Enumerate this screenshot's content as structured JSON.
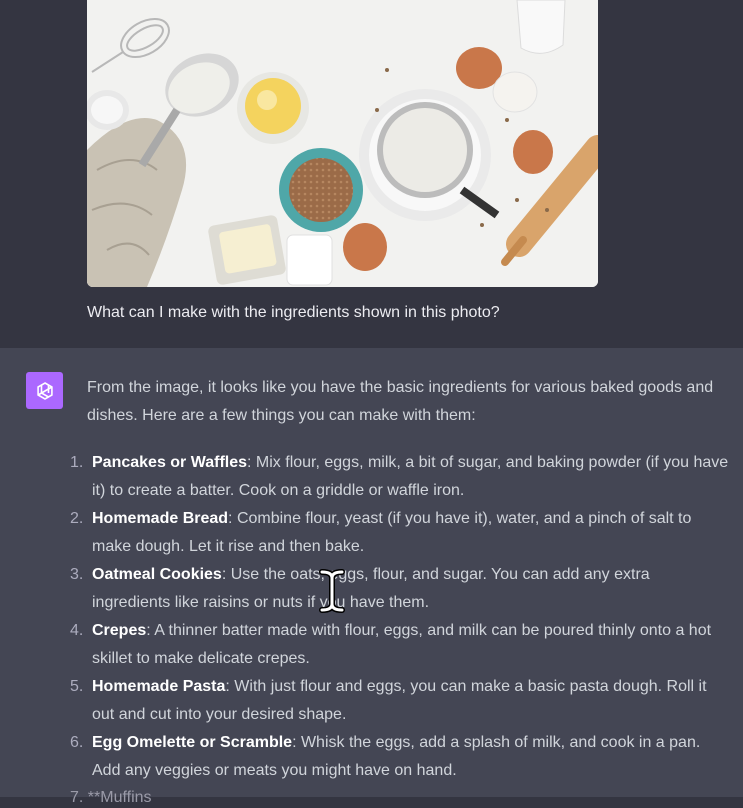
{
  "user_message": {
    "image": {
      "subject": "baking ingredients flat lay",
      "colors": {
        "background": "#f2f2f0",
        "egg": "#c9774a",
        "flour": "#efefea",
        "oats_bowl": "#4fa7a8",
        "wood": "#d9a46b"
      }
    },
    "text": "What can I make with the ingredients shown in this photo?"
  },
  "assistant_message": {
    "avatar_icon": "openai-logo-icon",
    "avatar_color": "#ab68ff",
    "intro": "From the image, it looks like you have the basic ingredients for various baked goods and dishes. Here are a few things you can make with them:",
    "items": [
      {
        "number": "1.",
        "title": "Pancakes or Waffles",
        "text": ": Mix flour, eggs, milk, a bit of sugar, and baking powder (if you have it) to create a batter. Cook on a griddle or waffle iron."
      },
      {
        "number": "2.",
        "title": "Homemade Bread",
        "text": ": Combine flour, yeast (if you have it), water, and a pinch of salt to make dough. Let it rise and then bake."
      },
      {
        "number": "3.",
        "title": "Oatmeal Cookies",
        "text": ": Use the oats, eggs, flour, and sugar. You can add any extra ingredients like raisins or nuts if you have them."
      },
      {
        "number": "4.",
        "title": "Crepes",
        "text": ": A thinner batter made with flour, eggs, and milk can be poured thinly onto a hot skillet to make delicate crepes."
      },
      {
        "number": "5.",
        "title": "Homemade Pasta",
        "text": ": With just flour and eggs, you can make a basic pasta dough. Roll it out and cut into your desired shape."
      },
      {
        "number": "6.",
        "title": "Egg Omelette or Scramble",
        "text": ": Whisk the eggs, add a splash of milk, and cook in a pan. Add any veggies or meats you might have on hand."
      }
    ],
    "truncated_line": "7. **Muffins"
  },
  "cursor_icon": "text-cursor-icon"
}
